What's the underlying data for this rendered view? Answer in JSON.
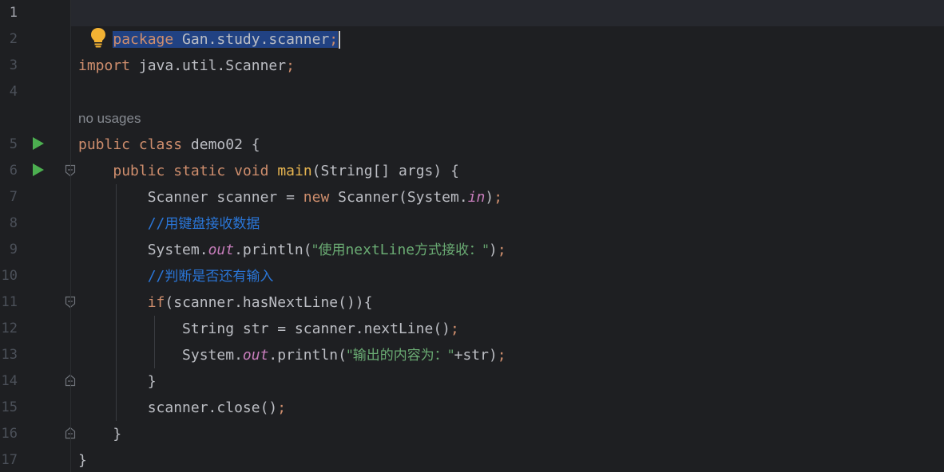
{
  "editor": {
    "line_numbers": [
      "1",
      "2",
      "3",
      "4",
      "5",
      "6",
      "7",
      "8",
      "9",
      "10",
      "11",
      "12",
      "13",
      "14",
      "15",
      "16",
      "17"
    ],
    "usages_hint": "no usages",
    "lines": {
      "l1": {
        "kw": "package",
        "rest": " Gan.study.scanner",
        "semi": ";"
      },
      "l3": {
        "kw": "import",
        "rest": " java.util.Scanner",
        "semi": ";"
      },
      "l5": {
        "kw1": "public",
        "kw2": "class",
        "rest": " demo02 {"
      },
      "l6": {
        "kw1": "public",
        "kw2": "static",
        "kw3": "void",
        "name": "main",
        "rest": "(String[] args) {"
      },
      "l7": {
        "a": "Scanner scanner = ",
        "kw": "new",
        "b": " Scanner(System.",
        "field": "in",
        "c": ")",
        "semi": ";"
      },
      "l8": {
        "slashes": "//",
        "text": "用键盘接收数据"
      },
      "l9": {
        "a": "System.",
        "field": "out",
        "b": ".println(",
        "q1": "\"使用",
        "mid": "nextLine",
        "q2": "方式接收：\"",
        "c": ")",
        "semi": ";"
      },
      "l10": {
        "slashes": "//",
        "text": "判断是否还有输入"
      },
      "l11": {
        "kw": "if",
        "rest": "(scanner.hasNextLine()){"
      },
      "l12": {
        "a": "String str = scanner.nextLine()",
        "semi": ";"
      },
      "l13": {
        "a": "System.",
        "field": "out",
        "b": ".println(",
        "q": "\"输出的内容为：\"",
        "c": "+str)",
        "semi": ";"
      },
      "l14": {
        "a": "}"
      },
      "l15": {
        "a": "scanner.close()",
        "semi": ";"
      },
      "l16": {
        "a": "}"
      },
      "l17": {
        "a": "}"
      }
    },
    "icons": {
      "bulb": "lightbulb-icon",
      "run": "run-gutter-icon",
      "fold": "fold-marker-icon"
    },
    "colors": {
      "background": "#1e1f22",
      "keyword": "#cf8e6d",
      "string": "#6aab73",
      "comment": "#2a76d8",
      "field": "#c77dbb",
      "method": "#e6b450",
      "selection": "#214283",
      "run": "#4caf50",
      "bulb": "#f2b233"
    }
  }
}
